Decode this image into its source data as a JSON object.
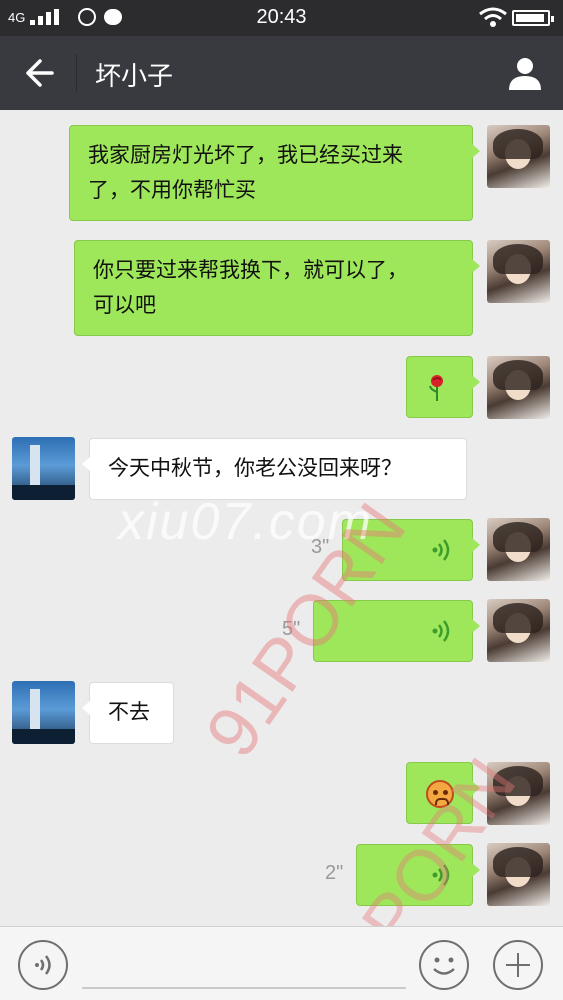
{
  "status_bar": {
    "network": "4G",
    "time": "20:43"
  },
  "header": {
    "title": "坏小子"
  },
  "messages": [
    {
      "from": "me",
      "type": "text",
      "text_line1": "我家厨房灯光坏了，我已经买过来",
      "text_line2": "了，不用你帮忙买"
    },
    {
      "from": "me",
      "type": "text",
      "text_line1": "你只要过来帮我换下，就可以了，",
      "text_line2": "可以吧"
    },
    {
      "from": "me",
      "type": "emoji",
      "icon": "rose-icon"
    },
    {
      "from": "contact",
      "type": "text",
      "text": "今天中秋节，你老公没回来呀？"
    },
    {
      "from": "me",
      "type": "voice",
      "duration": "3\""
    },
    {
      "from": "me",
      "type": "voice",
      "duration": "5\""
    },
    {
      "from": "contact",
      "type": "text",
      "text": "不去"
    },
    {
      "from": "me",
      "type": "emoji",
      "icon": "angry-face-icon"
    },
    {
      "from": "me",
      "type": "voice",
      "duration": "2\""
    }
  ],
  "watermarks": {
    "site": "xiu07.com",
    "mark": "91PORN"
  },
  "colors": {
    "outgoing_bubble": "#9ee65a",
    "incoming_bubble": "#ffffff",
    "nav_bar": "#393a3f",
    "chat_background": "#ececec"
  }
}
